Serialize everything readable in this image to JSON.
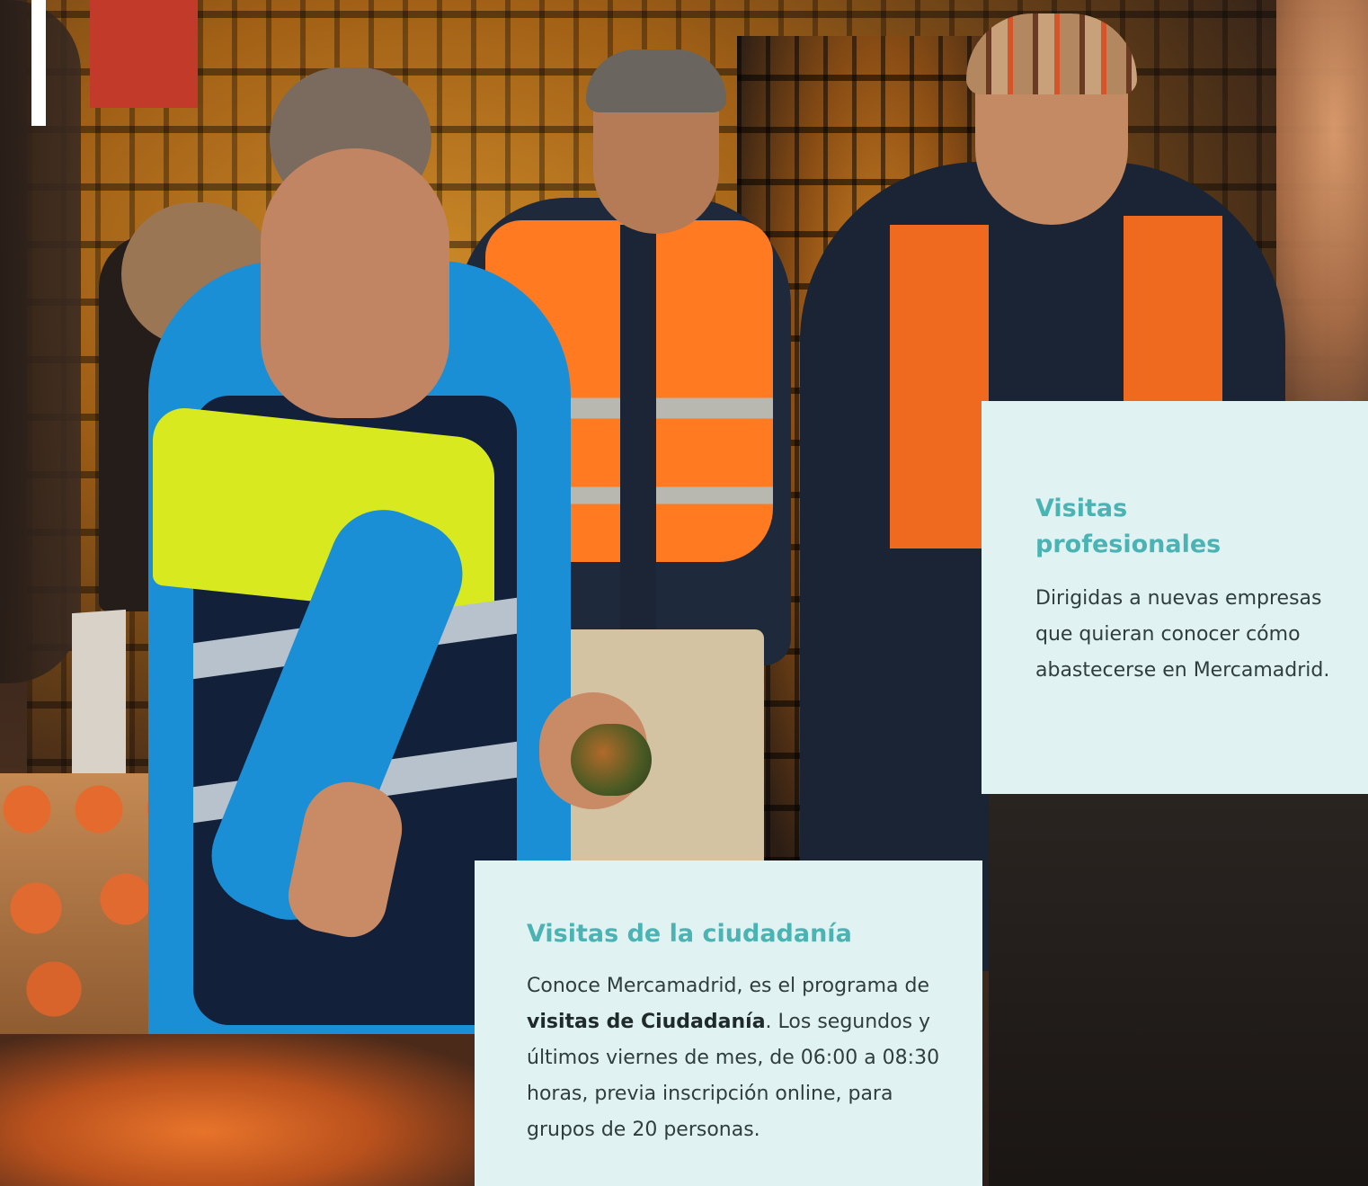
{
  "photo": {
    "alt_subject": "guide-with-visitors-at-market"
  },
  "cards": {
    "professional": {
      "title": "Visitas profesionales",
      "body": "Dirigidas a nuevas empresas que quieran conocer cómo abastecerse en Mercamadrid."
    },
    "citizens": {
      "title": "Visitas de la ciudadanía",
      "body_before_bold": "Conoce Mercamadrid, es el programa de ",
      "body_bold": "visitas de Ciudadanía",
      "body_after_bold": ". Los segundos y últimos viernes de mes, de 06:00 a 08:30 horas, previa inscripción online, para grupos de 20 personas."
    }
  },
  "colors": {
    "card_background": "#e1f2f2",
    "title_teal": "#4bb3b3",
    "body_text": "#2f3d3d"
  }
}
